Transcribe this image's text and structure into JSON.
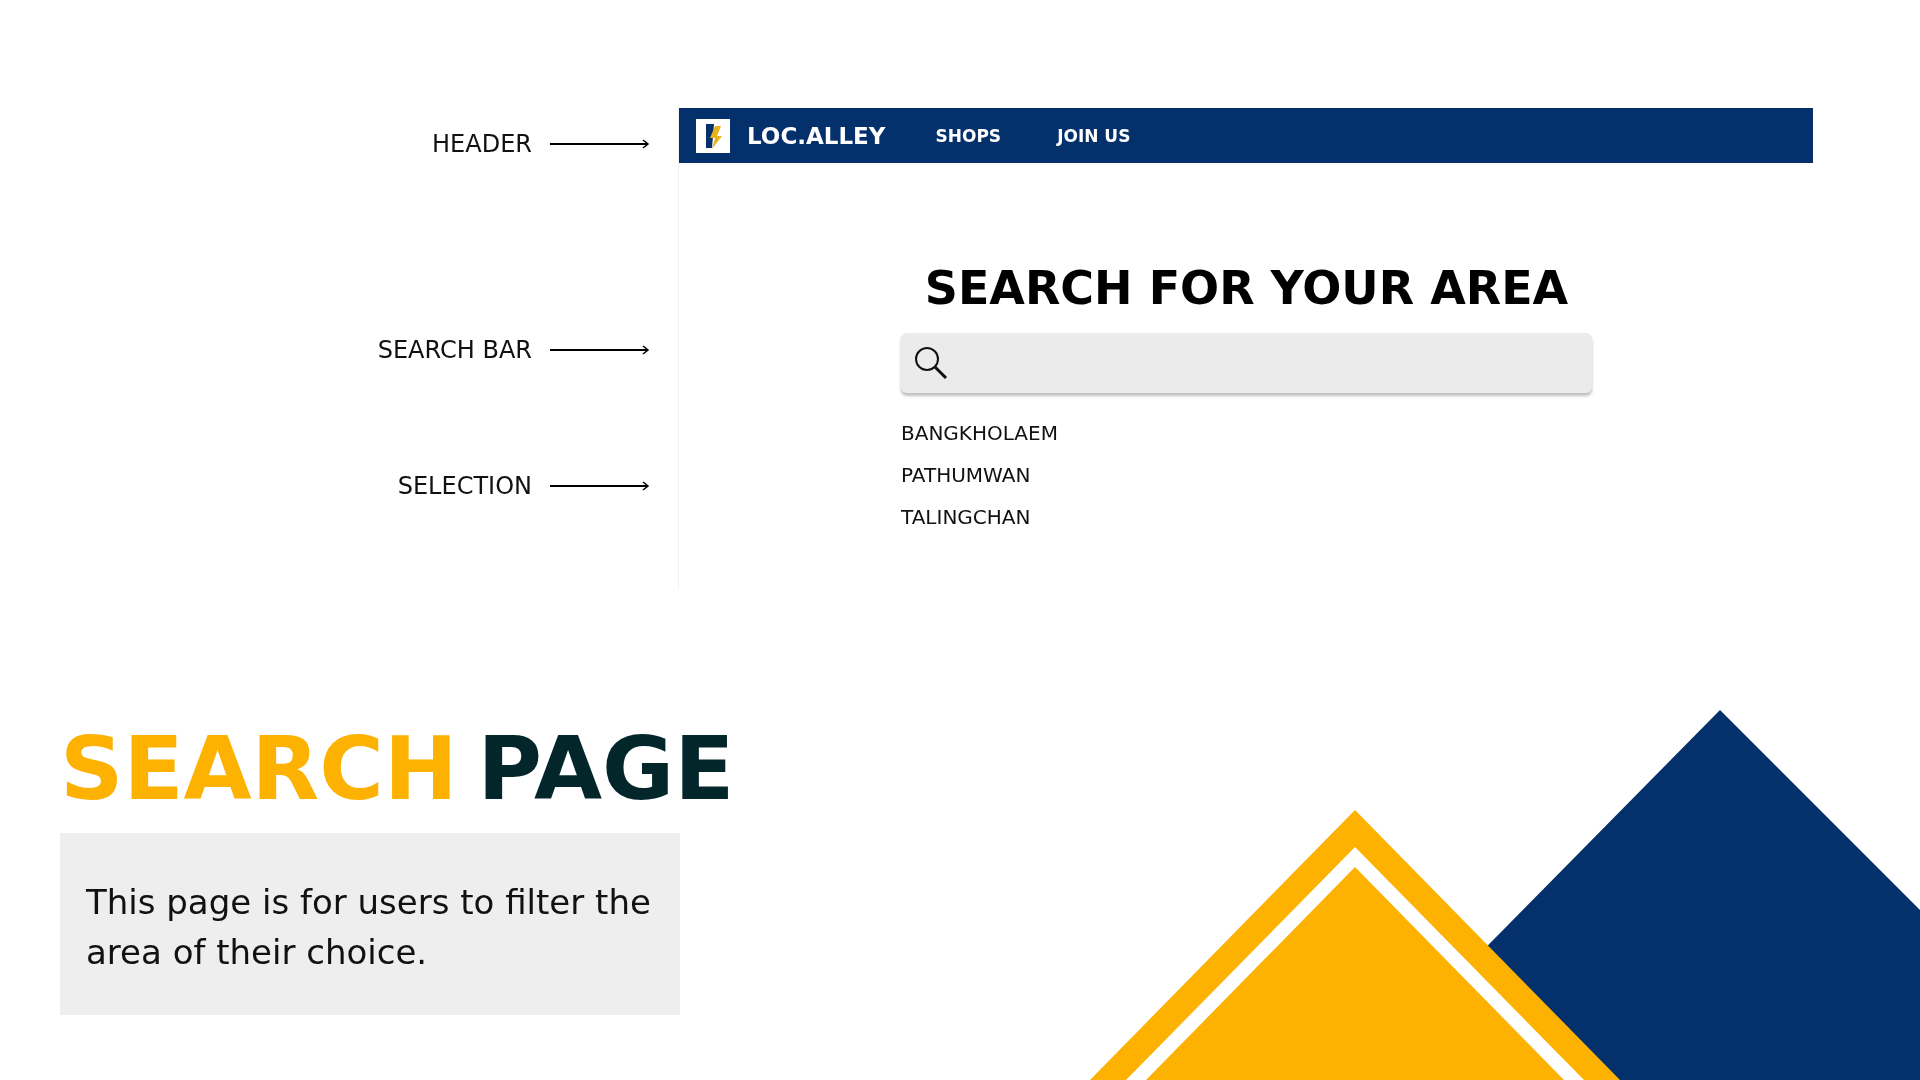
{
  "annotations": [
    {
      "label": "HEADER"
    },
    {
      "label": "SEARCH BAR"
    },
    {
      "label": "SELECTION"
    }
  ],
  "mockup": {
    "brand": "LOC.ALLEY",
    "nav": [
      {
        "label": "SHOPS"
      },
      {
        "label": "JOIN US"
      }
    ],
    "heading": "SEARCH FOR YOUR AREA",
    "results": [
      "BANGKHOLAEM",
      "PATHUMWAN",
      "TALINGCHAN"
    ]
  },
  "slide_title": {
    "highlight": "SEARCH",
    "rest": "PAGE"
  },
  "description": "This page is for users to filter the area of their choice."
}
